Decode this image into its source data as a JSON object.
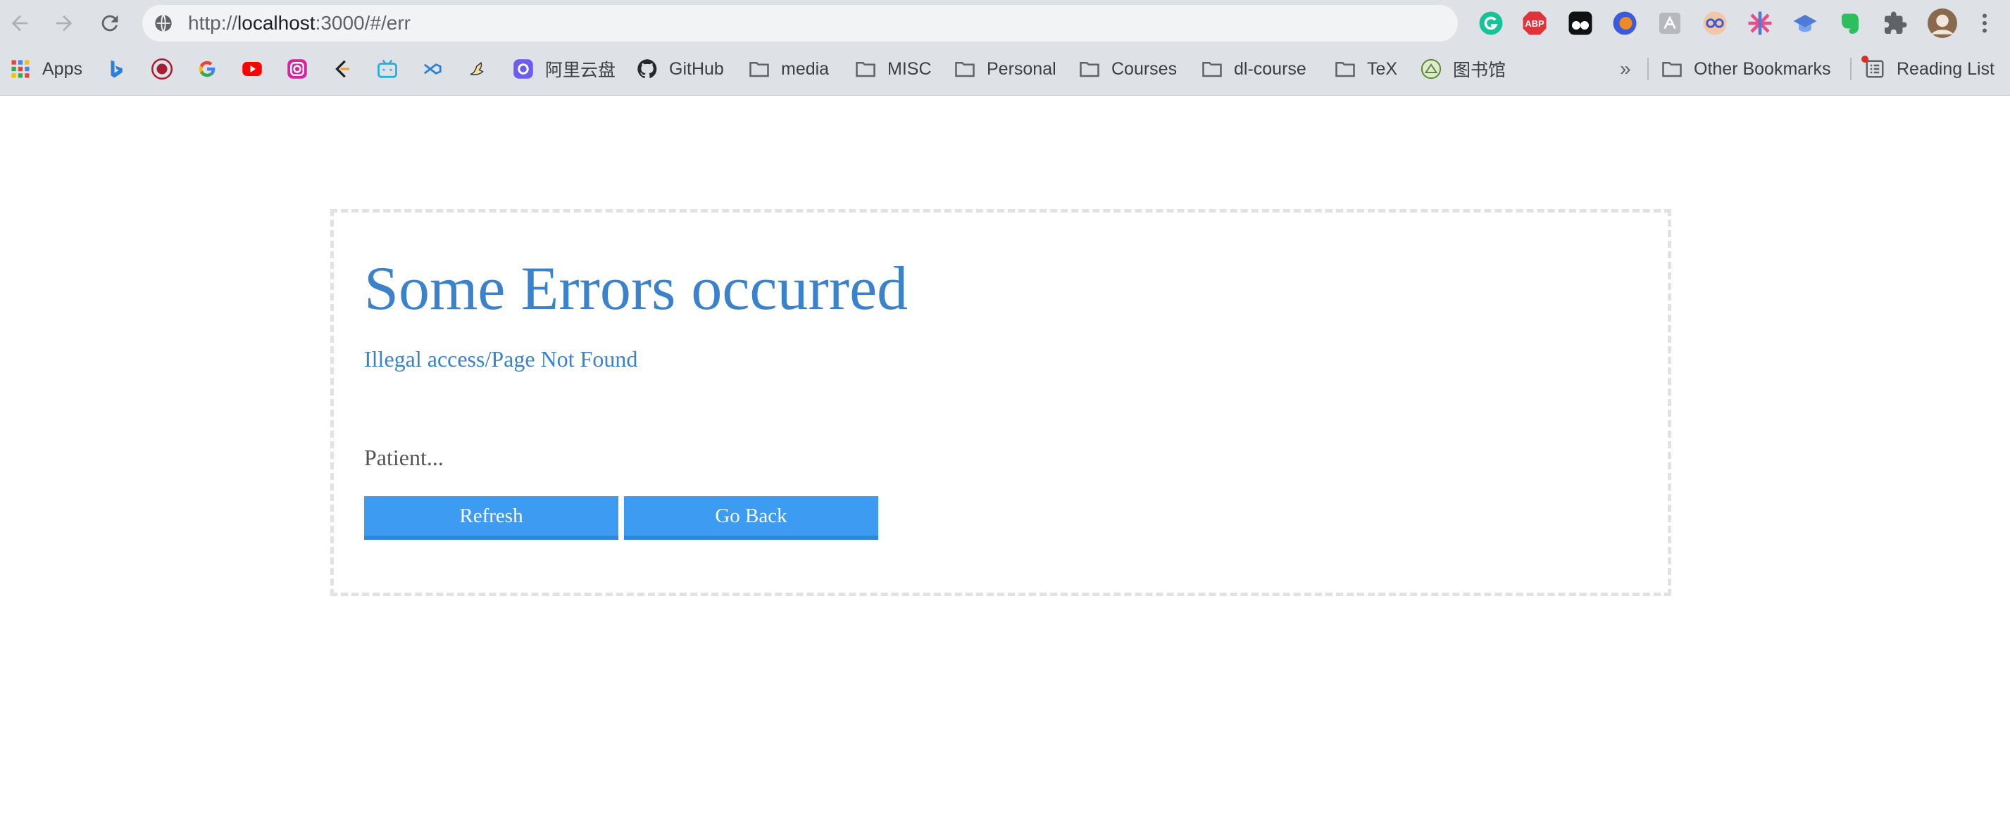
{
  "browser": {
    "url": {
      "scheme": "http://",
      "host": "localhost",
      "rest": ":3000/#/err"
    },
    "extensions": [
      {
        "name": "grammarly-icon",
        "color": "#15c39a"
      },
      {
        "name": "adblock-plus-icon",
        "color": "#e0343c",
        "text": "ABP"
      },
      {
        "name": "tampermonkey-icon",
        "color": "#000000"
      },
      {
        "name": "firefox-relay-icon",
        "color": "#3b5bdb"
      },
      {
        "name": "pdf-icon",
        "color": "#9aa0a6"
      },
      {
        "name": "reader-glasses-icon",
        "color": "#7b61ff"
      },
      {
        "name": "sparkle-icon",
        "color": "#e94d8a"
      },
      {
        "name": "graduation-cap-icon",
        "color": "#4f7bd8"
      },
      {
        "name": "evernote-icon",
        "color": "#2dbe60"
      },
      {
        "name": "puzzle-extensions-icon",
        "color": "#5f6368"
      }
    ],
    "bookmarks": {
      "apps_label": "Apps",
      "aliyun_label": "阿里云盘",
      "github_label": "GitHub",
      "media_label": "media",
      "misc_label": "MISC",
      "personal_label": "Personal",
      "courses_label": "Courses",
      "dlcourse_label": "dl-course",
      "tex_label": "TeX",
      "library_label": "图书馆",
      "overflow_label": "»",
      "other_label": "Other Bookmarks",
      "reading_label": "Reading List"
    }
  },
  "page": {
    "title": "Some Errors occurred",
    "subtitle": "Illegal access/Page Not Found",
    "message": "Patient...",
    "refresh_label": "Refresh",
    "back_label": "Go Back",
    "accent_color": "#3b82cc",
    "button_color": "#3e9bf2"
  }
}
